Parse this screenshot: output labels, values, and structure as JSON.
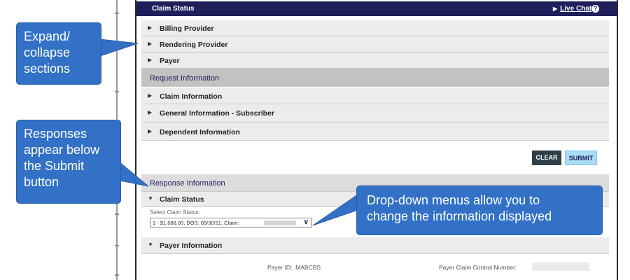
{
  "window": {
    "title": "Claim Status",
    "live_chat": "Live Chat",
    "help_glyph": "?"
  },
  "accordion": {
    "provider_sections": [
      {
        "label": "Billing Provider"
      },
      {
        "label": "Rendering Provider"
      },
      {
        "label": "Payer"
      }
    ],
    "request_header": "Request Information",
    "request_sections": [
      {
        "label": "Claim Information"
      },
      {
        "label": "General Information - Subscriber"
      },
      {
        "label": "Dependent Information"
      }
    ],
    "response_header": "Response Information",
    "claim_status_label": "Claim Status",
    "payer_information_label": "Payer Information"
  },
  "buttons": {
    "clear": "CLEAR",
    "submit": "SUBMIT"
  },
  "claim_select": {
    "label": "Select Claim Status:",
    "value": "1 - $1,688.00, DOS: 09/30/21, Claim:"
  },
  "payer_info": {
    "payer_id_label": "Payer ID:",
    "payer_id_value": "MABCBS",
    "payer_claim_control_label": "Payer Claim Control Number:"
  },
  "callouts": {
    "expand": [
      "Expand/",
      "collapse",
      "sections"
    ],
    "responses": [
      "Responses",
      "appear below",
      "the Submit",
      "button"
    ],
    "dropdowns": [
      "Drop-down menus allow you to",
      "change the information displayed"
    ]
  },
  "colors": {
    "title_bar": "#1f1f5c",
    "callout": "#3271c6",
    "clear_button": "#2f3f4a",
    "submit_button": "#a9dcf7"
  },
  "icons": {
    "collapsed": "triangle-right-icon",
    "expanded": "triangle-down-icon",
    "dropdown": "chevron-down-icon",
    "help": "help-icon"
  }
}
